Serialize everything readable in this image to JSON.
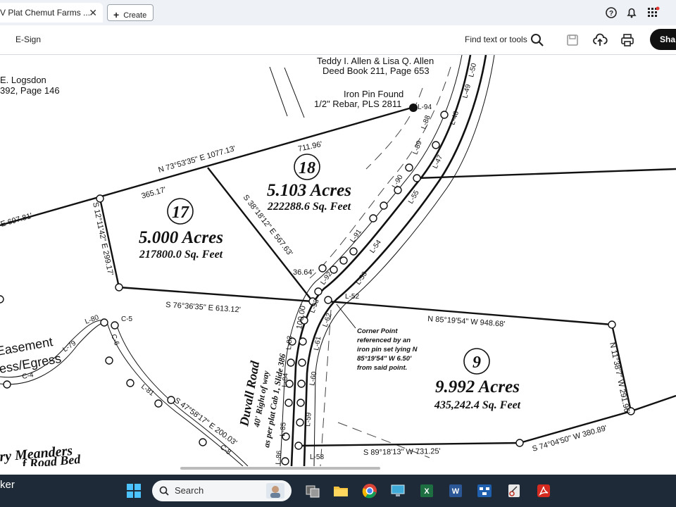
{
  "browser": {
    "tab_title": "V Plat Chemut Farms ...",
    "close_glyph": "✕",
    "create_label": "Create"
  },
  "toolbar": {
    "esign_label": "E-Sign",
    "find_label": "Find text or tools",
    "share_label": "Sha"
  },
  "plat": {
    "owners_top": "Teddy I. Allen & Lisa Q. Allen",
    "deed_top": "Deed Book 211, Page 653",
    "owner_left": "E. Logsdon",
    "deed_left": "392, Page 146",
    "iron_pin_title": "Iron Pin Found",
    "iron_pin_detail": "1/2\" Rebar, PLS 2811",
    "lot18_number": "18",
    "lot18_acres": "5.103 Acres",
    "lot18_sqft": "222288.6 Sq. Feet",
    "lot17_number": "17",
    "lot17_acres": "5.000 Acres",
    "lot17_sqft": "217800.0 Sq. Feet",
    "lot9_number": "9",
    "lot9_acres": "9.992 Acres",
    "lot9_sqft": "435,242.4 Sq. Feet",
    "bearing_n73": "N 73°53'35\" E  1077.13'",
    "dist_711": "711.96'",
    "dist_365": "365.17'",
    "bearing_e697": "E  697.81'",
    "bearing_s12": "S 12°11'42\" E  299.17'",
    "bearing_s38": "S 38°18'12\" E  567.63'",
    "dist_3664": "36.64'",
    "bearing_s76": "S 76°36'35\" E  613.12'",
    "bearing_n85": "N 85°19'54\" W  948.68'",
    "bearing_n11": "N 11°38'7\" W  291.96'",
    "bearing_s74": "S 74°04'50\" W  380.89'",
    "bearing_s89": "S 89°18'13\" W  731.25'",
    "bearing_s47": "S 47°58'17\" E  200.03'",
    "dist_100": "100.00'",
    "corner_note_1": "Corner Point",
    "corner_note_2": "referenced by an",
    "corner_note_3": "iron pin set lying N",
    "corner_note_4": "85°19'54\" W  6.50'",
    "corner_note_5": "from said point.",
    "road_name": "Duvall Road",
    "road_row": "40' Right of way",
    "road_plat": "as per plat Cab 1, Slide 386",
    "easement_1": "Easement",
    "easement_2": "ess/Egress",
    "meanders": "ry Meanders",
    "roadbed": "f Road Bed",
    "line_labels": [
      "L-94",
      "L-88",
      "L-89",
      "L-90",
      "L-91",
      "L-92",
      "L-93",
      "L-50",
      "L-49",
      "L-48",
      "L-47",
      "L-55",
      "L-54",
      "L-53",
      "L-52",
      "L-62",
      "L-61",
      "L-60",
      "L-59",
      "L-83",
      "L-84",
      "L-85",
      "L-86",
      "L-58",
      "L-80",
      "L-79",
      "C-5",
      "C-6",
      "C-4",
      "C-8",
      "L-81"
    ]
  },
  "taskbar": {
    "left_text": "ker",
    "search_placeholder": "Search"
  },
  "colors": {
    "taskbar": "#1e2a38",
    "share": "#111111",
    "excel": "#1d6f42",
    "word": "#2b5797",
    "acrobat": "#d42a1f"
  }
}
